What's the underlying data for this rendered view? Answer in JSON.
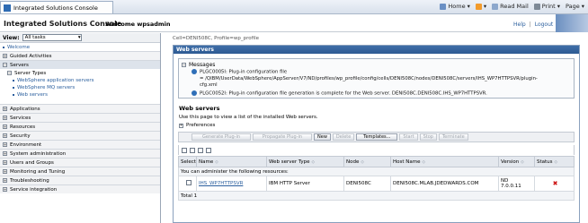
{
  "browser": {
    "tab_title": "Integrated Solutions Console",
    "tools": [
      "Home",
      "Read Mail",
      "Print",
      "Page"
    ]
  },
  "header": {
    "title": "Integrated Solutions Console",
    "welcome": "Welcome wpsadmin",
    "help": "Help",
    "separator": "|",
    "logout": "Logout"
  },
  "nav": {
    "view_label": "View:",
    "view_value": "All tasks",
    "welcome": "Welcome",
    "items": [
      "Guided Activities",
      "Servers",
      "Applications",
      "Services",
      "Resources",
      "Security",
      "Environment",
      "System administration",
      "Users and Groups",
      "Monitoring and Tuning",
      "Troubleshooting",
      "Service integration"
    ],
    "server_types": "Server Types",
    "server_links": [
      "WebSphere application servers",
      "WebSphere MQ servers",
      "Web servers"
    ]
  },
  "main": {
    "breadcrumb": "Cell=DENI508C, Profile=wp_profile",
    "panel_title": "Web servers",
    "messages_label": "Messages",
    "msg1_a": "PLGC0005I: Plug-in configuration file",
    "msg1_b": "= /QIBM/UserData/WebSphere/AppServer/V7/ND/profiles/wp_profile/config/cells/DENI508C/nodes/DENI508C/servers/IHS_WP7HTTPSVR/plugin-",
    "msg1_c": "cfg.xml",
    "msg2": "PLGC0052I: Plug-in configuration file generation is complete for the Web server. DENI508C.DENI508C.IHS_WP7HTTPSVR.",
    "ws_title": "Web servers",
    "ws_desc": "Use this page to view a list of the installed Web servers.",
    "preferences": "Preferences",
    "buttons": {
      "generate": "Generate Plug-in",
      "propagate": "Propagate Plug-in",
      "new": "New",
      "delete": "Delete",
      "templates": "Templates...",
      "start": "Start",
      "stop": "Stop",
      "terminate": "Terminate"
    },
    "table": {
      "headers": [
        "Select",
        "Name",
        "Web server Type",
        "Node",
        "Host Name",
        "Version",
        "Status"
      ],
      "admin_note": "You can administer the following resources:",
      "row": {
        "name": "IHS_WP7HTTPSVR",
        "type": "IBM HTTP Server",
        "node": "DENI508C",
        "host": "DENI508C.MLAB.JDEDWARDS.COM",
        "version_a": "ND",
        "version_b": "7.0.0.11",
        "status": "✖"
      },
      "total": "Total 1"
    }
  }
}
